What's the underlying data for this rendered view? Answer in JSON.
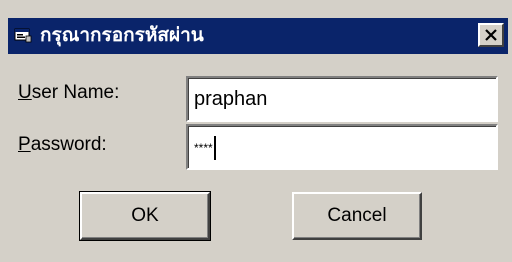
{
  "window": {
    "title": "กรุณากรอกรหัสผ่าน",
    "app_icon": "dialog-window-icon",
    "close_icon": "close-icon",
    "titlebar_color": "#0a246a"
  },
  "form": {
    "username_label_mnemonic": "U",
    "username_label_rest": "ser Name:",
    "username_value": "praphan",
    "password_label_mnemonic": "P",
    "password_label_rest": "assword:",
    "password_value": "****"
  },
  "buttons": {
    "ok_label": "OK",
    "cancel_label": "Cancel"
  }
}
